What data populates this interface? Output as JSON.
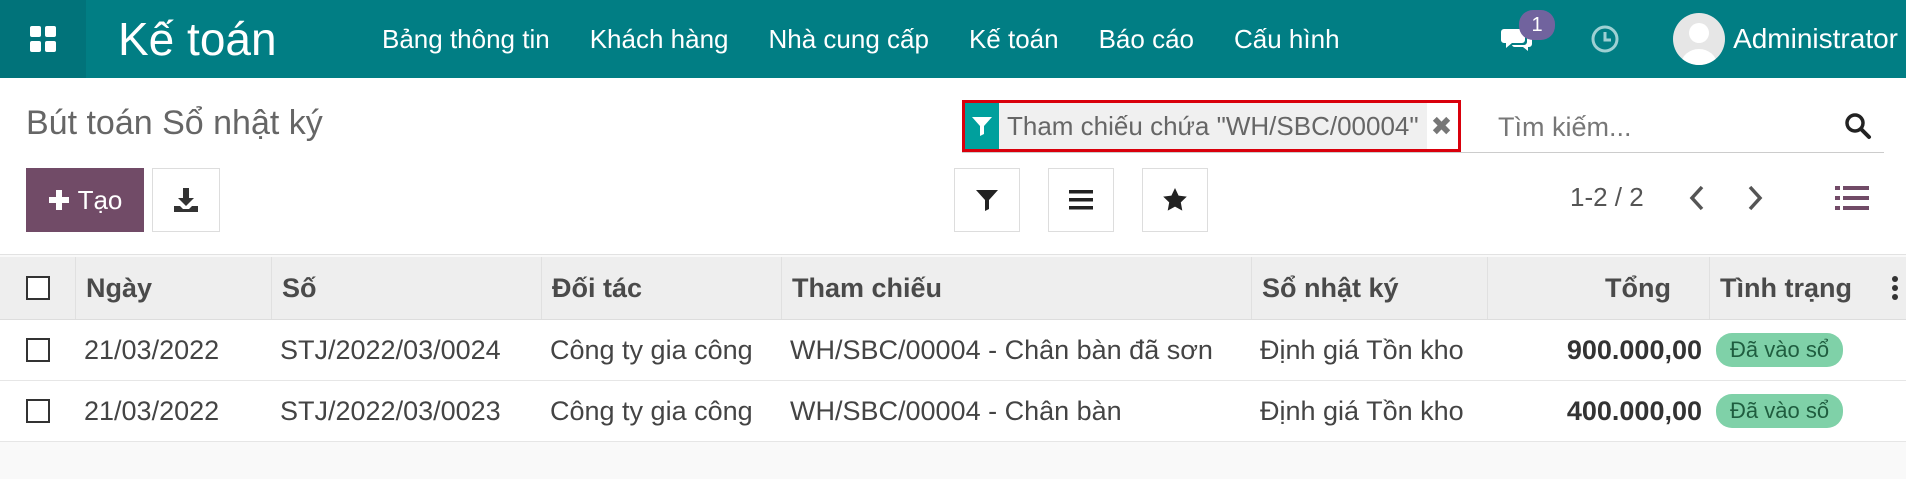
{
  "navbar": {
    "brand": "Kế toán",
    "menu": [
      "Bảng thông tin",
      "Khách hàng",
      "Nhà cung cấp",
      "Kế toán",
      "Báo cáo",
      "Cấu hình"
    ],
    "chat_badge": "1",
    "user_name": "Administrator"
  },
  "control_panel": {
    "title": "Bút toán Sổ nhật ký",
    "create_label": "Tạo",
    "facet_text": "Tham chiếu chứa \"WH/SBC/00004\"",
    "search_placeholder": "Tìm kiếm...",
    "pager": "1-2 / 2"
  },
  "table": {
    "headers": [
      "Ngày",
      "Số",
      "Đối tác",
      "Tham chiếu",
      "Sổ nhật ký",
      "Tổng",
      "Tình trạng"
    ],
    "rows": [
      {
        "date": "21/03/2022",
        "number": "STJ/2022/03/0024",
        "partner": "Công ty gia công",
        "reference": "WH/SBC/00004 - Chân bàn đã sơn",
        "journal": "Định giá Tồn kho",
        "total": "900.000,00",
        "status": "Đã vào sổ"
      },
      {
        "date": "21/03/2022",
        "number": "STJ/2022/03/0023",
        "partner": "Công ty gia công",
        "reference": "WH/SBC/00004 - Chân bàn",
        "journal": "Định giá Tồn kho",
        "total": "400.000,00",
        "status": "Đã vào sổ"
      }
    ]
  },
  "colors": {
    "navbar": "#017e84",
    "primary_button": "#714b67",
    "status_posted": "#7fd1a8",
    "facet_highlight": "#d9000c"
  }
}
